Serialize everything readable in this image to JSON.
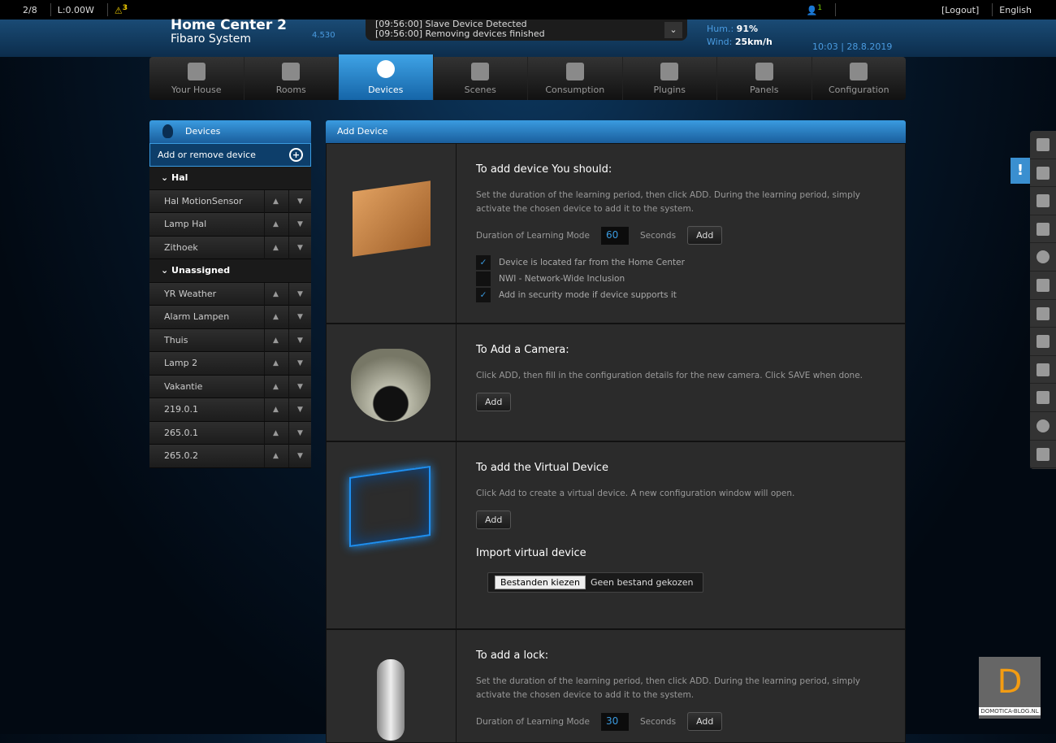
{
  "topbar": {
    "devices_count": "2/8",
    "power": "L:0.00W",
    "alerts": "3",
    "user_badge": "1",
    "logout": "[Logout]",
    "language": "English"
  },
  "header": {
    "title_line1": "Home Center 2",
    "subtitle": "Fibaro System",
    "version": "4.530",
    "log": [
      "[09:56:00] Slave Device Detected",
      "[09:56:00] Removing devices finished"
    ],
    "humidity_label": "Hum.:",
    "humidity": "91%",
    "wind_label": "Wind:",
    "wind": "25km/h",
    "datetime": "10:03 | 28.8.2019"
  },
  "nav": [
    "Your House",
    "Rooms",
    "Devices",
    "Scenes",
    "Consumption",
    "Plugins",
    "Panels",
    "Configuration"
  ],
  "sidebar": {
    "title": "Devices",
    "add": "Add or remove device",
    "items": [
      {
        "label": "Hal",
        "group": true
      },
      {
        "label": "Hal MotionSensor"
      },
      {
        "label": "Lamp Hal"
      },
      {
        "label": "Zithoek"
      },
      {
        "label": "Unassigned",
        "group": true
      },
      {
        "label": "YR Weather"
      },
      {
        "label": "Alarm Lampen"
      },
      {
        "label": "Thuis"
      },
      {
        "label": "Lamp 2"
      },
      {
        "label": "Vakantie"
      },
      {
        "label": "219.0.1"
      },
      {
        "label": "265.0.1"
      },
      {
        "label": "265.0.2"
      }
    ]
  },
  "main": {
    "title": "Add Device",
    "device": {
      "heading": "To add device You should:",
      "text": "Set the duration of the learning period, then click ADD. During the learning period, simply activate the chosen device to add it to the system.",
      "duration_label": "Duration of Learning Mode",
      "duration": "60",
      "seconds": "Seconds",
      "add": "Add",
      "options": [
        {
          "label": "Device is located far from the Home Center",
          "checked": true
        },
        {
          "label": "NWI - Network-Wide Inclusion",
          "checked": false
        },
        {
          "label": "Add in security mode if device supports it",
          "checked": true
        }
      ]
    },
    "camera": {
      "heading": "To Add a Camera:",
      "text": "Click ADD, then fill in the configuration details for the new camera. Click SAVE when done.",
      "add": "Add"
    },
    "virtual": {
      "heading": "To add the Virtual Device",
      "text": "Click Add to create a virtual device. A new configuration window will open.",
      "add": "Add",
      "import_heading": "Import virtual device",
      "choose": "Bestanden kiezen",
      "no_file": "Geen bestand gekozen"
    },
    "lock": {
      "heading": "To add a lock:",
      "text": "Set the duration of the learning period, then click ADD. During the learning period, simply activate the chosen device to add it to the system.",
      "duration_label": "Duration of Learning Mode",
      "duration": "30",
      "seconds": "Seconds",
      "add": "Add"
    }
  },
  "watermark": "DOMOTICA-BLOG.NL"
}
